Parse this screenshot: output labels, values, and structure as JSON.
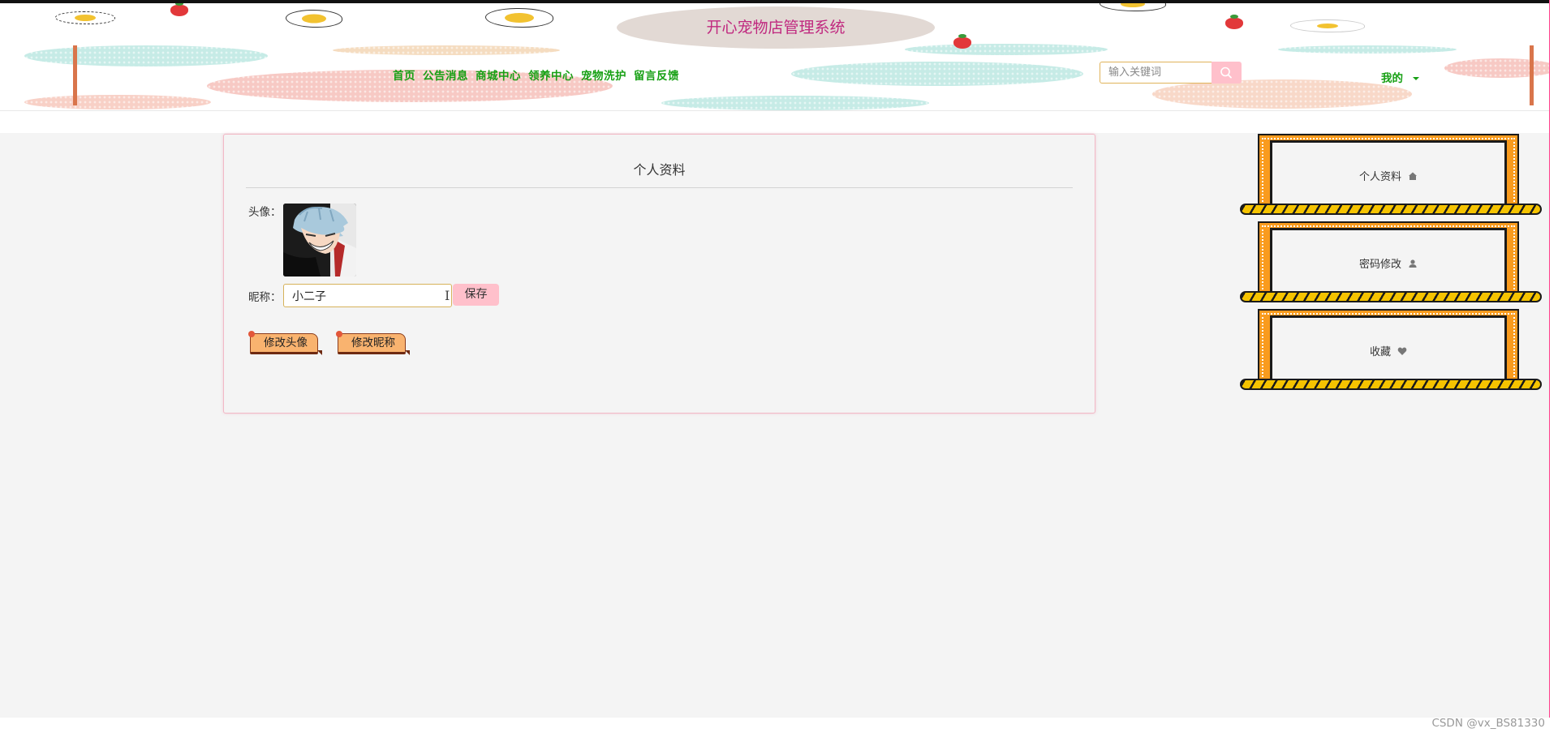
{
  "site": {
    "title": "开心宠物店管理系统"
  },
  "nav": {
    "items": [
      {
        "label": "首页"
      },
      {
        "label": "公告消息"
      },
      {
        "label": "商城中心"
      },
      {
        "label": "领养中心"
      },
      {
        "label": "宠物洗护"
      },
      {
        "label": "留言反馈"
      }
    ]
  },
  "search": {
    "placeholder": "输入关键词",
    "value": "",
    "icon": "search-icon"
  },
  "user_menu": {
    "label": "我的"
  },
  "profile": {
    "title": "个人资料",
    "avatar_label": "头像：",
    "nickname_label": "昵称：",
    "nickname_value": "小二子",
    "save_label": "保存",
    "change_avatar_label": "修改头像",
    "change_nickname_label": "修改昵称"
  },
  "sidebar": {
    "items": [
      {
        "label": "个人资料",
        "icon": "home-icon"
      },
      {
        "label": "密码修改",
        "icon": "user-icon"
      },
      {
        "label": "收藏",
        "icon": "heart-icon"
      }
    ]
  },
  "colors": {
    "title_text": "#c0287f",
    "nav_text": "#17a014",
    "accent_pink": "#ffc0cb",
    "sidebar_orange": "#f99b1e",
    "sidebar_yellow": "#f5c300"
  },
  "watermark": "CSDN @vx_BS81330"
}
